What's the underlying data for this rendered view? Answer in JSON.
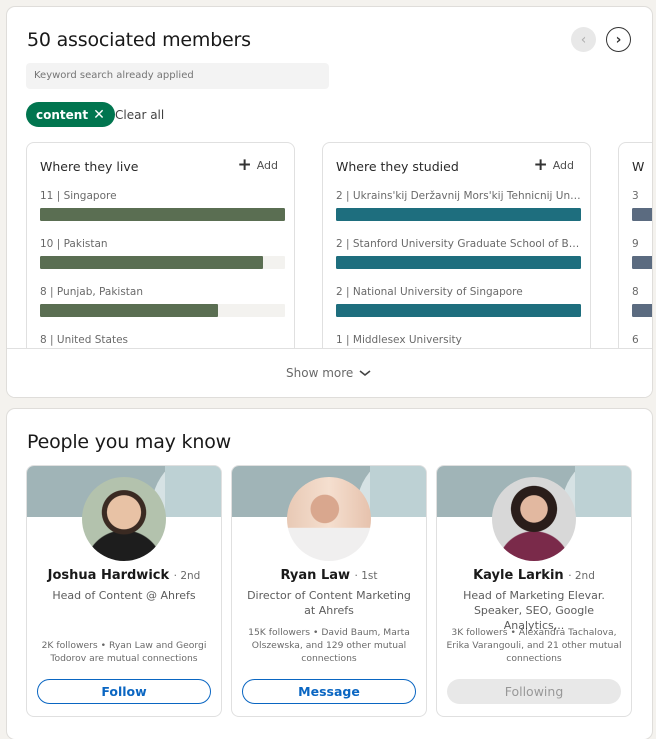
{
  "insights": {
    "title": "50 associated members",
    "search_placeholder": "Keyword search already applied",
    "active_filter": "content",
    "clear_all": "Clear all",
    "show_more": "Show more",
    "facets": [
      {
        "title": "Where they live",
        "add_label": "Add",
        "color": "#5a6e52",
        "max": 11,
        "rows": [
          {
            "count": 11,
            "label": "Singapore"
          },
          {
            "count": 10,
            "label": "Pakistan"
          },
          {
            "count": 8,
            "label": "Punjab, Pakistan"
          },
          {
            "count": 8,
            "label": "United States"
          }
        ]
      },
      {
        "title": "Where they studied",
        "add_label": "Add",
        "color": "#1e6e7e",
        "max": 2,
        "rows": [
          {
            "count": 2,
            "label": "Ukrains'kij Deržavnij Mors'kij Tehnicnij Uniw..."
          },
          {
            "count": 2,
            "label": "Stanford University Graduate School of Busi..."
          },
          {
            "count": 2,
            "label": "National University of Singapore"
          },
          {
            "count": 1,
            "label": "Middlesex University"
          }
        ]
      },
      {
        "title": "W",
        "color": "#5b6b80",
        "max": 3,
        "rows": [
          {
            "count": "3",
            "label": ""
          },
          {
            "count": "9",
            "label": ""
          },
          {
            "count": "8",
            "label": ""
          },
          {
            "count": "6",
            "label": ""
          }
        ]
      }
    ]
  },
  "pymk": {
    "title": "People you may know",
    "people": [
      {
        "name": "Joshua Hardwick",
        "degree": "· 2nd",
        "headline": "Head of Content @ Ahrefs",
        "mutual": "2K followers • Ryan Law and Georgi Todorov are mutual connections",
        "action": "Follow",
        "action_state": "outline"
      },
      {
        "name": "Ryan Law",
        "degree": "· 1st",
        "headline": "Director of Content Marketing at Ahrefs",
        "mutual": "15K followers • David Baum, Marta Olszewska, and 129 other mutual connections",
        "action": "Message",
        "action_state": "outline"
      },
      {
        "name": "Kayle Larkin",
        "degree": "· 2nd",
        "headline": "Head of Marketing Elevar. Speaker, SEO, Google Analytics,..",
        "mutual": "3K followers • Alexandra Tachalova, Erika Varangouli, and 21 other mutual connections",
        "action": "Following",
        "action_state": "disabled"
      }
    ]
  }
}
